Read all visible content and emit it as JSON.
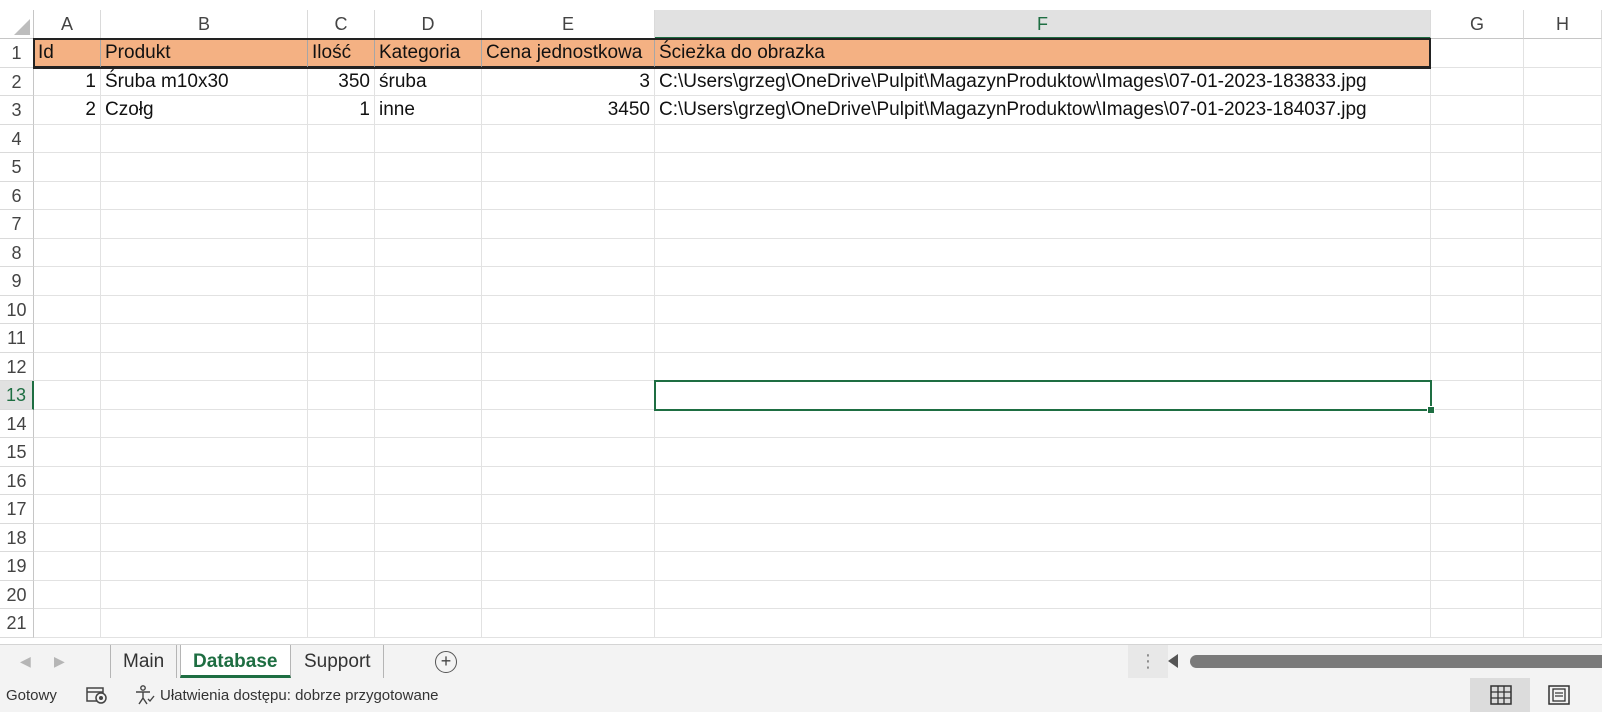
{
  "spreadsheet": {
    "columns": [
      "A",
      "B",
      "C",
      "D",
      "E",
      "F",
      "G",
      "H"
    ],
    "selected_column": "F",
    "rows": [
      "1",
      "2",
      "3",
      "4",
      "5",
      "6",
      "7",
      "8",
      "9",
      "10",
      "11",
      "12",
      "13",
      "14",
      "15",
      "16",
      "17",
      "18",
      "19",
      "20",
      "21"
    ],
    "selected_row": "13",
    "header_row": {
      "A": "Id",
      "B": "Produkt",
      "C": "Ilość",
      "D": "Kategoria",
      "E": "Cena jednostkowa",
      "F": "Ścieżka do obrazka"
    },
    "data_rows": [
      {
        "A": "1",
        "B": "Śruba m10x30",
        "C": "350",
        "D": "śruba",
        "E": "3",
        "F": "C:\\Users\\grzeg\\OneDrive\\Pulpit\\MagazynProduktow\\Images\\07-01-2023-183833.jpg"
      },
      {
        "A": "2",
        "B": "Czołg",
        "C": "1",
        "D": "inne",
        "E": "3450",
        "F": "C:\\Users\\grzeg\\OneDrive\\Pulpit\\MagazynProduktow\\Images\\07-01-2023-184037.jpg"
      }
    ],
    "header_fill_color": "#f4b183",
    "accent_color": "#1e6e42"
  },
  "sheet_tabs": {
    "tabs": [
      "Main",
      "Database",
      "Support"
    ],
    "active_tab": "Database",
    "prev_icon": "chevron-left-icon",
    "next_icon": "chevron-right-icon",
    "add_icon": "plus-circle-icon",
    "add_symbol": "+"
  },
  "status_bar": {
    "ready_text": "Gotowy",
    "accessibility_text": "Ułatwienia dostępu: dobrze przygotowane",
    "macro_icon": "macro-record-icon",
    "accessibility_icon": "accessibility-icon",
    "view_normal_icon": "grid-view-icon",
    "view_page_layout_icon": "page-layout-icon"
  }
}
